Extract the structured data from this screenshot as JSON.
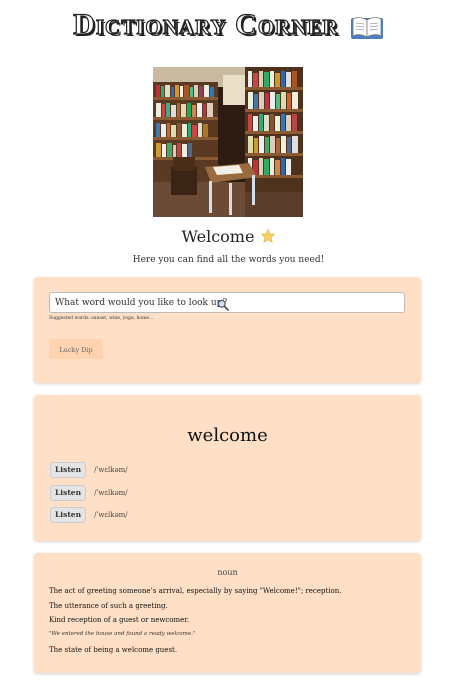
{
  "header": {
    "title": "Dictionary Corner",
    "icon": "open-book-icon"
  },
  "photo": {
    "icon": "bookshelf-room-photo"
  },
  "intro": {
    "heading": "Welcome",
    "heading_icon": "star-icon",
    "tagline": "Here you can find all the words you need!"
  },
  "search": {
    "placeholder": "What word would you like to look up?",
    "icon": "magnifier-icon",
    "suggested": "Suggested words: sunset, wine, yoga, home...",
    "lucky_label": "Lucky Dip"
  },
  "result": {
    "word": "welcome",
    "pronunciations": [
      {
        "button": "Listen",
        "phonetic": "/ˈwɛlkəm/"
      },
      {
        "button": "Listen",
        "phonetic": "/ˈwɛlkəm/"
      },
      {
        "button": "Listen",
        "phonetic": "/ˈwɛlkəm/"
      }
    ]
  },
  "meaning": {
    "part_of_speech": "noun",
    "definitions": [
      "The act of greeting someone’s arrival, especially by saying \"Welcome!\"; reception.",
      "The utterance of such a greeting.",
      "Kind reception of a guest or newcomer.",
      "The state of being a welcome guest."
    ],
    "example": "\"We entered the house and found a ready welcome.\""
  },
  "colors": {
    "card_background": "#ffdfc6",
    "lucky_button": "#ffd2b0",
    "listen_button": "#e4e4e4"
  }
}
